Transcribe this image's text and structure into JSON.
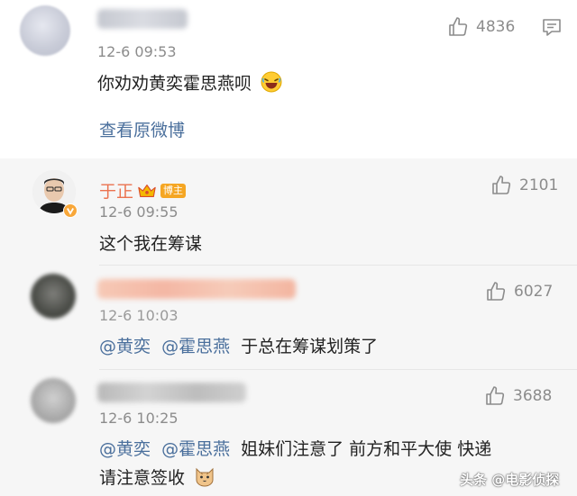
{
  "top_comment": {
    "time": "12-6 09:53",
    "likes": "4836",
    "text": "你劝劝黄奕霍思燕呗",
    "view_original": "查看原微博"
  },
  "replies": [
    {
      "user": "于正",
      "badge": "博主",
      "time": "12-6 09:55",
      "likes": "2101",
      "text": "这个我在筹谋"
    },
    {
      "time": "12-6 10:03",
      "likes": "6027",
      "mention1": "@黄奕",
      "mention2": "@霍思燕",
      "text": "于总在筹谋划策了"
    },
    {
      "time": "12-6 10:25",
      "likes": "3688",
      "mention1": "@黄奕",
      "mention2": "@霍思燕",
      "text_line1": "姐妹们注意了 前方和平大使 快递",
      "text_line2": "请注意签收"
    }
  ],
  "watermark": "头条 @电影侦探",
  "icons": {
    "like": "thumbs-up-icon",
    "comment": "comment-icon",
    "verified": "verified-v-icon",
    "crown": "crown-icon",
    "laugh_emoji": "laughing-emoji-icon",
    "cat_emoji": "cat-emoji-icon"
  },
  "colors": {
    "mention": "#4a6f9c",
    "blogger_name": "#eb7350",
    "reply_background": "#f6f6f6"
  }
}
